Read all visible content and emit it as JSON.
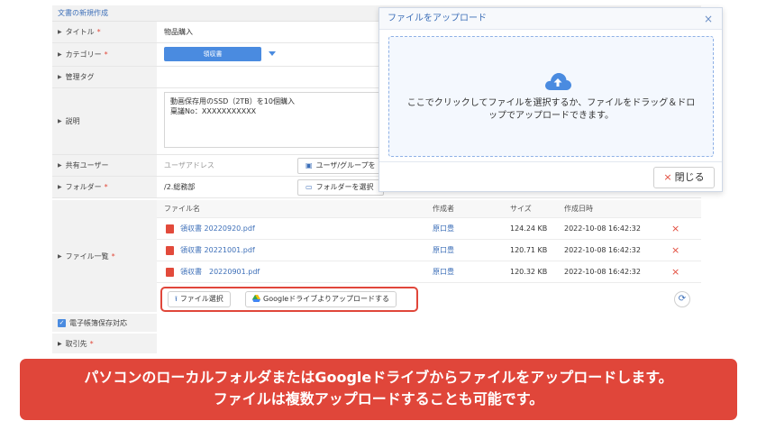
{
  "form": {
    "header": "文書の新規作成",
    "title_label": "タイトル",
    "title_value": "物品購入",
    "category_label": "カテゴリー",
    "category_value": "領収書",
    "tags_label": "管理タグ",
    "description_label": "説明",
    "description_lines": [
      "動画保存用のSSD（2TB）を10個購入",
      "稟議No：XXXXXXXXXXX"
    ],
    "shared_users_label": "共有ユーザー",
    "user_address_placeholder": "ユーザアドレス",
    "user_group_button": "ユーザ/グループを",
    "folder_label": "フォルダー",
    "folder_value": "/2.総務部",
    "folder_button": "フォルダーを選択",
    "file_list_label": "ファイル一覧",
    "required_mark": "*",
    "electronic_storage_label": "電子帳簿保存対応",
    "supplier_label": "取引先"
  },
  "files": {
    "columns": [
      "ファイル名",
      "作成者",
      "サイズ",
      "作成日時"
    ],
    "rows": [
      {
        "name": "領収書 20220920.pdf",
        "author": "原口豊",
        "size": "124.24 KB",
        "date": "2022-10-08 16:42:32"
      },
      {
        "name": "領収書 20221001.pdf",
        "author": "原口豊",
        "size": "120.71 KB",
        "date": "2022-10-08 16:42:32"
      },
      {
        "name": "領収書　20220901.pdf",
        "author": "原口豊",
        "size": "120.32 KB",
        "date": "2022-10-08 16:42:32"
      }
    ],
    "delete_glyph": "×",
    "select_file_button": "ファイル選択",
    "google_drive_button": "Googleドライブよりアップロードする"
  },
  "modal": {
    "title": "ファイルをアップロード",
    "close_glyph": "×",
    "drop_text_line1": "ここでクリックしてファイルを選択するか、ファイルをドラッグ＆ドロ",
    "drop_text_line2": "ップでアップロードできます。",
    "close_button": "閉じる"
  },
  "banner": {
    "line1": "パソコンのローカルフォルダまたはGoogleドライブからファイルをアップロードします。",
    "line2": "ファイルは複数アップロードすることも可能です。"
  },
  "colors": {
    "accent": "#4a8be0",
    "link": "#3d6fb8",
    "danger": "#e0463a"
  }
}
